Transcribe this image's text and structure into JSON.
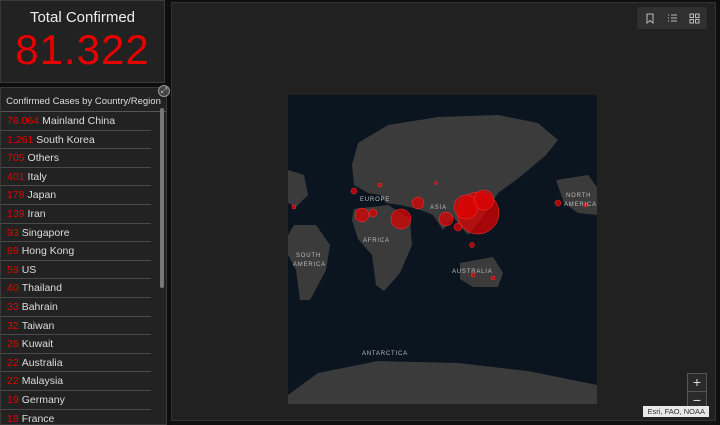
{
  "total": {
    "title": "Total Confirmed",
    "value": "81.322"
  },
  "list": {
    "header": "Confirmed Cases by Country/Region",
    "items": [
      {
        "num": "78.064",
        "name": "Mainland China"
      },
      {
        "num": "1.261",
        "name": "South Korea"
      },
      {
        "num": "705",
        "name": "Others"
      },
      {
        "num": "401",
        "name": "Italy"
      },
      {
        "num": "178",
        "name": "Japan"
      },
      {
        "num": "139",
        "name": "Iran"
      },
      {
        "num": "93",
        "name": "Singapore"
      },
      {
        "num": "89",
        "name": "Hong Kong"
      },
      {
        "num": "59",
        "name": "US"
      },
      {
        "num": "40",
        "name": "Thailand"
      },
      {
        "num": "33",
        "name": "Bahrain"
      },
      {
        "num": "32",
        "name": "Taiwan"
      },
      {
        "num": "26",
        "name": "Kuwait"
      },
      {
        "num": "22",
        "name": "Australia"
      },
      {
        "num": "22",
        "name": "Malaysia"
      },
      {
        "num": "19",
        "name": "Germany"
      },
      {
        "num": "18",
        "name": "France"
      }
    ]
  },
  "map": {
    "labels": {
      "europe": "EUROPE",
      "africa": "AFRICA",
      "asia": "ASIA",
      "australia": "AUSTRALIA",
      "antarctica": "ANTARCTICA",
      "south_america_1": "SOUTH",
      "south_america_2": "AMERICA",
      "north_america_1": "NORTH",
      "north_america_2": "AMERICA"
    },
    "zoom_in": "+",
    "zoom_out": "−",
    "attribution": "Esri, FAO, NOAA",
    "icons": [
      "bookmark-icon",
      "list-icon",
      "qr-icon"
    ]
  },
  "colors": {
    "accent": "#e60000",
    "panel": "#222222",
    "ocean": "#0b1520",
    "land": "#3b3b3b"
  }
}
